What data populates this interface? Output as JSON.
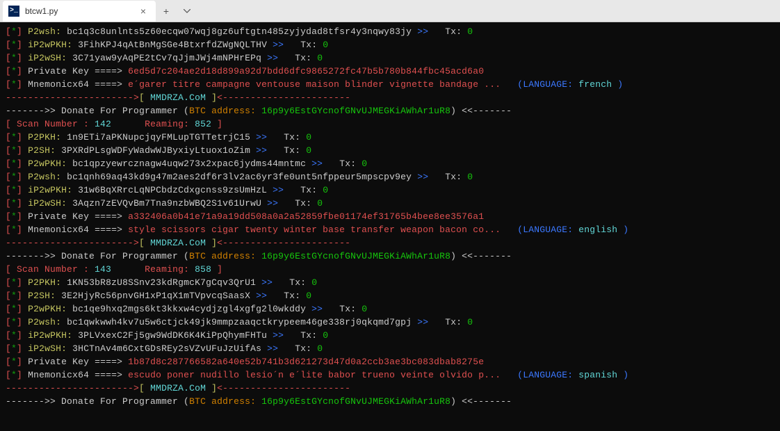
{
  "tab": {
    "title": "btcw1.py"
  },
  "blocks": [
    {
      "lines": [
        {
          "label": "P2wsh",
          "addr": "bc1q3c8unlnts5z60ecqw07wqj8gz6uftgtn485zyjydad8tfsr4y3nqwy83jy",
          "tx": "0"
        },
        {
          "label": "iP2wPKH",
          "addr": "3FihKPJ4qAtBnMgSGe4BtxrfdZWgNQLTHV",
          "tx": "0"
        },
        {
          "label": "iP2wSH",
          "addr": "3C71yaw9yAqPE2tCv7qJjmJWj4mNPHrEPq",
          "tx": "0"
        }
      ],
      "privkey": "6ed5d7c204ae2d18d899a92d7bdd6dfc9865272fc47b5b780b844fbc45acd6a0",
      "mnemonic": "e´garer titre campagne ventouse maison blinder vignette bandage ...",
      "language": "french",
      "scan": "142",
      "reaming": "852"
    },
    {
      "lines": [
        {
          "label": "P2PKH",
          "addr": "1n9ETi7aPKNupcjqyFMLupTGTTetrjC15",
          "tx": "0"
        },
        {
          "label": "P2SH",
          "addr": "3PXRdPLsgWDFyWadwWJByxiyLtuox1oZim",
          "tx": "0"
        },
        {
          "label": "P2wPKH",
          "addr": "bc1qpzyewrcznagw4uqw273x2xpac6jydms44mntmc",
          "tx": "0"
        },
        {
          "label": "P2wsh",
          "addr": "bc1qnh69aq43kd9g47m2aes2df6r3lv2ac6yr3fe0unt5nfppeur5mpscpv9ey",
          "tx": "0"
        },
        {
          "label": "iP2wPKH",
          "addr": "31w6BqXRrcLqNPCbdzCdxgcnss9zsUmHzL",
          "tx": "0"
        },
        {
          "label": "iP2wSH",
          "addr": "3Aqzn7zEVQvBm7Tna9nzbWBQ2S1v61UrwU",
          "tx": "0"
        }
      ],
      "privkey": "a332406a0b41e71a9a19dd508a0a2a52859fbe01174ef31765b4bee8ee3576a1",
      "mnemonic": "style scissors cigar twenty winter base transfer weapon bacon co...",
      "language": "english",
      "scan": "143",
      "reaming": "858"
    },
    {
      "lines": [
        {
          "label": "P2PKH",
          "addr": "1KN53bR8zU8SSnv23kdRgmcK7gCqv3QrU1",
          "tx": "0"
        },
        {
          "label": "P2SH",
          "addr": "3E2HjyRc56pnvGH1xP1qX1mTVpvcqSaasX",
          "tx": "0"
        },
        {
          "label": "P2wPKH",
          "addr": "bc1qe9hxq2mgs6kt3kkxw4cydjzgl4xgfg2l0wkddy",
          "tx": "0"
        },
        {
          "label": "P2wsh",
          "addr": "bc1qwkwwh4kv7u5w6ctjck49jk9mmpzaaqctkrypeem46ge338rj0qkqmd7gpj",
          "tx": "0"
        },
        {
          "label": "iP2wPKH",
          "addr": "3PLVxexC2Fj5gw9WdDK6K4KiPpQhymFHTu",
          "tx": "0"
        },
        {
          "label": "iP2wSH",
          "addr": "3HCTnAv4m6CxtGDsREy2sVZvUFuJzUifAs",
          "tx": "0"
        }
      ],
      "privkey": "1b87d8c287766582a640e52b741b3d621273d47d0a2ccb3ae3bc083dbab8275e",
      "mnemonic": "escudo poner nudillo lesio´n e´lite babor trueno veinte olvido p...",
      "language": "spanish",
      "scan": null,
      "reaming": null
    }
  ],
  "labels": {
    "privkey": "Private Key ====>",
    "mnemonic": "Mnemonicx64 ====>",
    "lang_prefix": "(LANGUAGE:",
    "lang_suffix": ")",
    "tx_prefix": "Tx:",
    "dashes_short": "-----------------------",
    "site": "MMDRZA.CoM",
    "donate_prefix": "------->>",
    "donate_text": "Donate For Programmer (",
    "btc_text": "BTC address:",
    "btc_addr": "16p9y6EstGYcnofGNvUJMEGKiAWhAr1uR8",
    "donate_suffix": ") <<-------",
    "scan_label": "[ Scan Number :",
    "reaming_label": "Reaming:",
    "close_bracket": "]"
  }
}
